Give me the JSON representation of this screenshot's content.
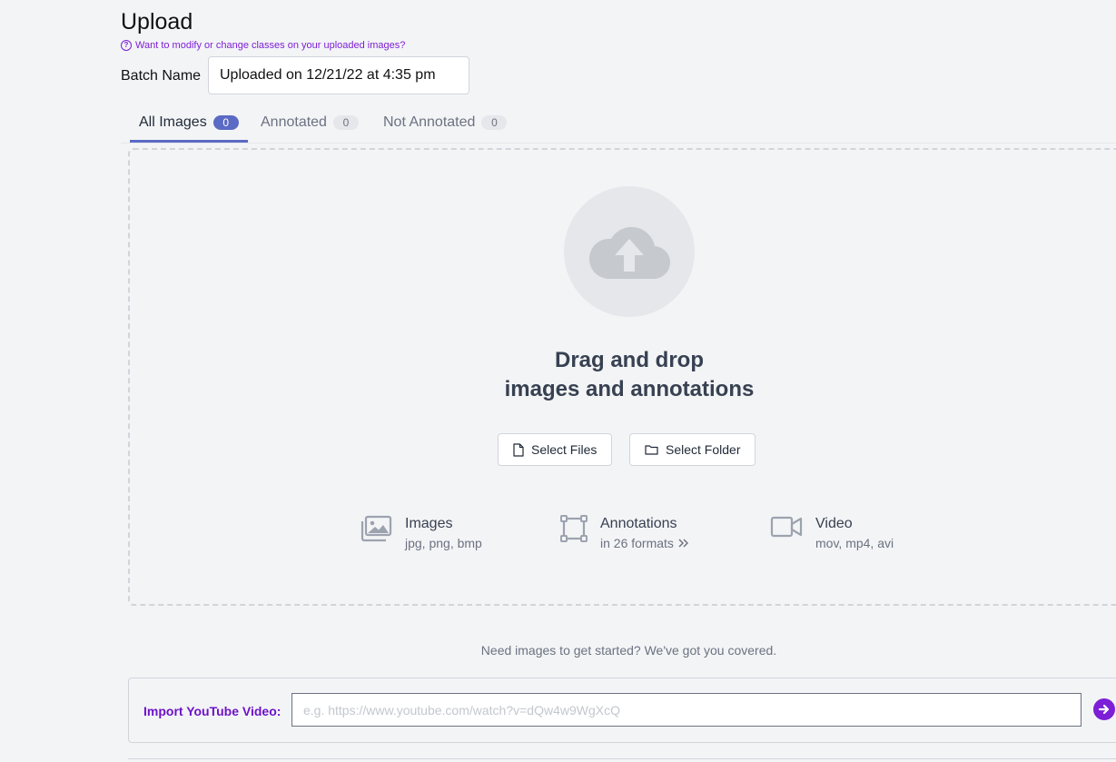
{
  "page": {
    "title": "Upload",
    "help_link": "Want to modify or change classes on your uploaded images?"
  },
  "batch": {
    "label": "Batch Name",
    "value": "Uploaded on 12/21/22 at 4:35 pm"
  },
  "tabs": [
    {
      "label": "All Images",
      "count": "0",
      "active": true
    },
    {
      "label": "Annotated",
      "count": "0",
      "active": false
    },
    {
      "label": "Not Annotated",
      "count": "0",
      "active": false
    }
  ],
  "dropzone": {
    "title_line1": "Drag and drop",
    "title_line2": "images and annotations",
    "select_files": "Select Files",
    "select_folder": "Select Folder",
    "formats": [
      {
        "name": "Images",
        "sub": "jpg, png, bmp",
        "icon": "images-icon"
      },
      {
        "name": "Annotations",
        "sub": "in 26 formats",
        "icon": "bounding-box-icon"
      },
      {
        "name": "Video",
        "sub": "mov, mp4, avi",
        "icon": "video-camera-icon"
      }
    ]
  },
  "help_text": "Need images to get started? We've got you covered.",
  "youtube": {
    "label": "Import YouTube Video:",
    "placeholder": "e.g. https://www.youtube.com/watch?v=dQw4w9WgXcQ",
    "value": ""
  },
  "colors": {
    "accent": "#5b6ac4",
    "purple": "#7c1fd6",
    "background": "#f3f4f6"
  }
}
